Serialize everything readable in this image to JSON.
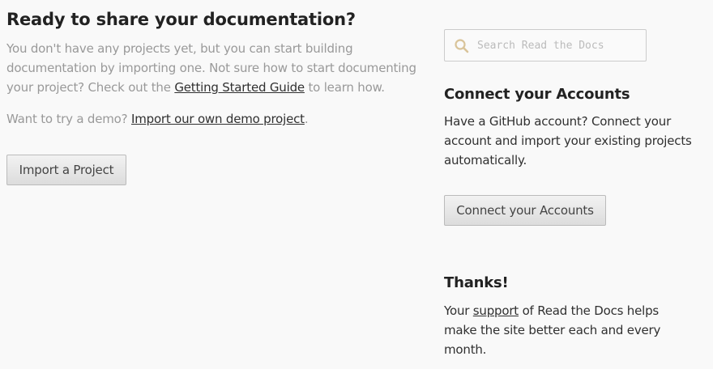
{
  "main": {
    "title": "Ready to share your documentation?",
    "intro_text_before": "You don't have any projects yet, but you can start building documentation by importing one. Not sure how to start documenting your project? Check out the ",
    "intro_link": "Getting Started Guide",
    "intro_text_after": " to learn how.",
    "demo_text_before": "Want to try a demo? ",
    "demo_link": "Import our own demo project",
    "demo_text_after": ".",
    "import_button": "Import a Project"
  },
  "sidebar": {
    "search": {
      "placeholder": "Search Read the Docs",
      "value": "",
      "icon": "search-icon"
    },
    "connect": {
      "title": "Connect your Accounts",
      "text": "Have a GitHub account? Connect your account and import your existing projects automatically.",
      "button": "Connect your Accounts"
    },
    "thanks": {
      "title": "Thanks!",
      "text_before": "Your ",
      "link": "support",
      "text_after": " of Read the Docs helps make the site better each and every month."
    }
  },
  "colors": {
    "background": "#f9f9f9",
    "muted_text": "#999999",
    "text": "#303030",
    "search_icon": "#d9c49a"
  }
}
